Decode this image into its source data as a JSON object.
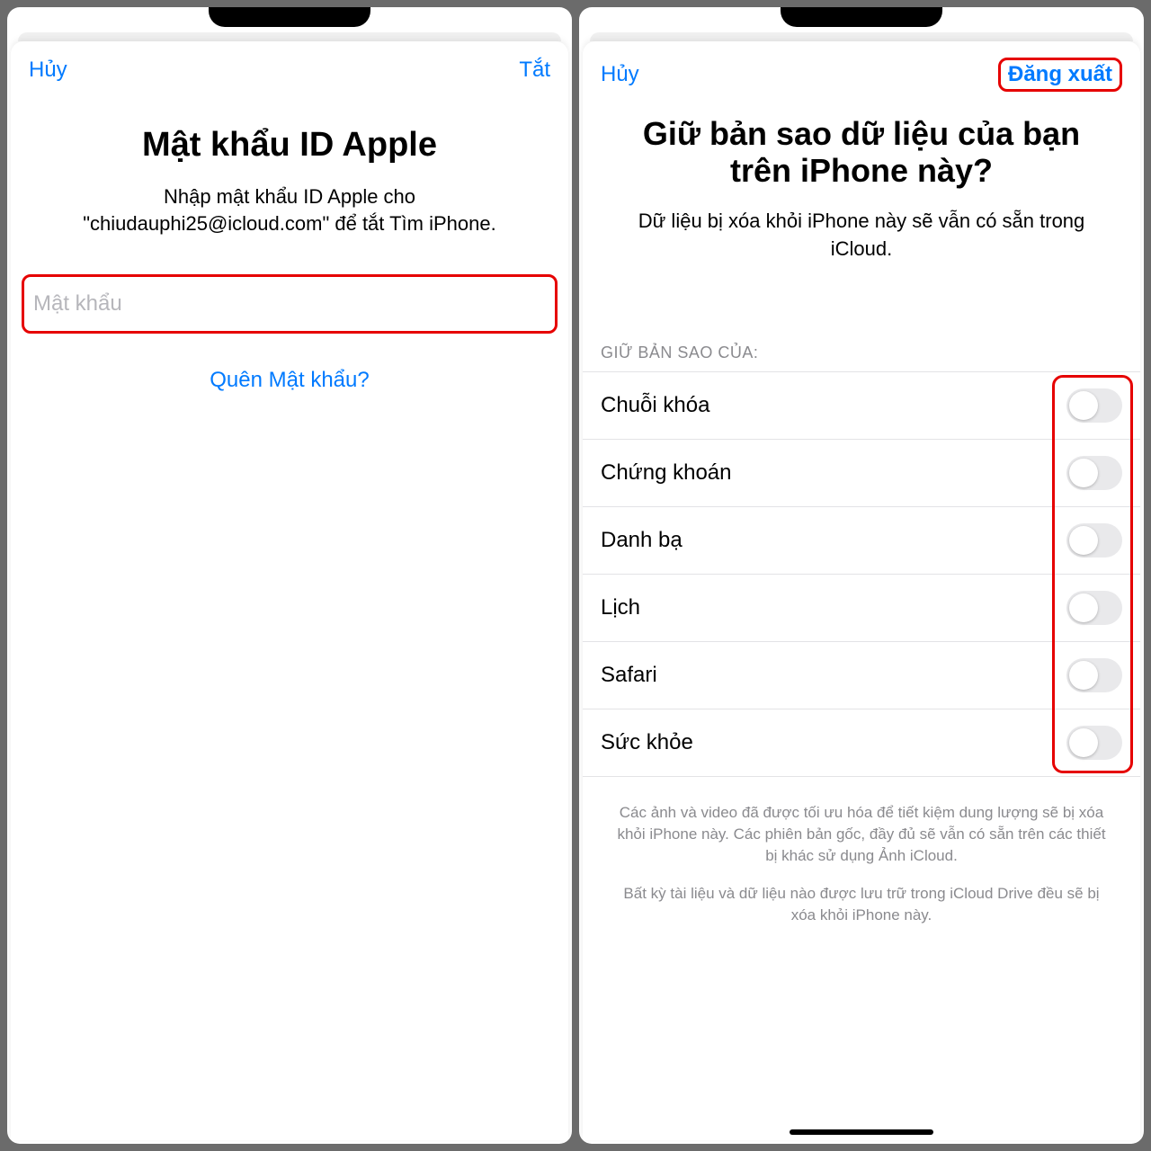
{
  "left": {
    "nav": {
      "cancel": "Hủy",
      "off": "Tắt"
    },
    "title": "Mật khẩu ID Apple",
    "subtitle": "Nhập mật khẩu ID Apple cho \"chiudauphi25@icloud.com\" để tắt Tìm iPhone.",
    "password_placeholder": "Mật khẩu",
    "forgot": "Quên Mật khẩu?"
  },
  "right": {
    "nav": {
      "cancel": "Hủy",
      "signout": "Đăng xuất"
    },
    "title": "Giữ bản sao dữ liệu của bạn trên iPhone này?",
    "subtitle": "Dữ liệu bị xóa khỏi iPhone này sẽ vẫn có sẵn trong iCloud.",
    "section_header": "GIỮ BẢN SAO CỦA:",
    "items": [
      {
        "label": "Chuỗi khóa"
      },
      {
        "label": "Chứng khoán"
      },
      {
        "label": "Danh bạ"
      },
      {
        "label": "Lịch"
      },
      {
        "label": "Safari"
      },
      {
        "label": "Sức khỏe"
      }
    ],
    "footnote1": "Các ảnh và video đã được tối ưu hóa để tiết kiệm dung lượng sẽ bị xóa khỏi iPhone này. Các phiên bản gốc, đầy đủ sẽ vẫn có sẵn trên các thiết bị khác sử dụng Ảnh iCloud.",
    "footnote2": "Bất kỳ tài liệu và dữ liệu nào được lưu trữ trong iCloud Drive đều sẽ bị xóa khỏi iPhone này."
  }
}
